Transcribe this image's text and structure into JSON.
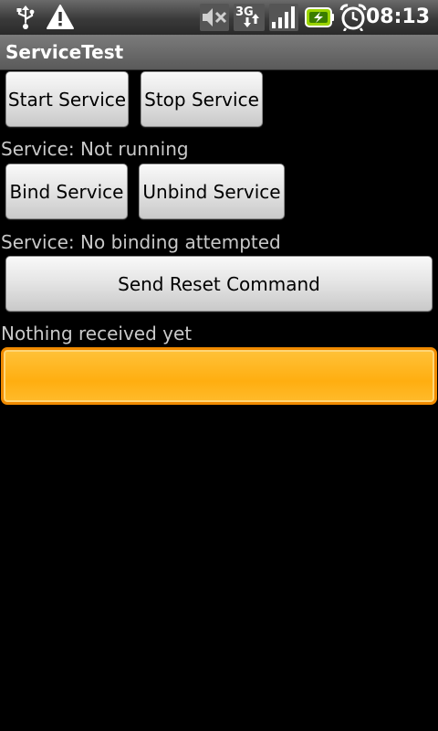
{
  "status_bar": {
    "time": "08:13",
    "icons": [
      "usb-icon",
      "warning-icon",
      "mute-icon",
      "3g-data-icon",
      "signal-strength-icon",
      "battery-charging-icon",
      "alarm-clock-icon"
    ]
  },
  "app": {
    "title": "ServiceTest"
  },
  "controls": {
    "start_service_label": "Start Service",
    "stop_service_label": "Stop Service",
    "service_status": "Service: Not running",
    "bind_service_label": "Bind Service",
    "unbind_service_label": "Unbind Service",
    "binding_status": "Service: No binding attempted",
    "send_reset_label": "Send Reset Command",
    "received_status": "Nothing received yet",
    "input_value": ""
  },
  "colors": {
    "focus_border": "#f08a00",
    "focus_fill": "#ffb81e",
    "label_text": "#c9c9c9"
  }
}
